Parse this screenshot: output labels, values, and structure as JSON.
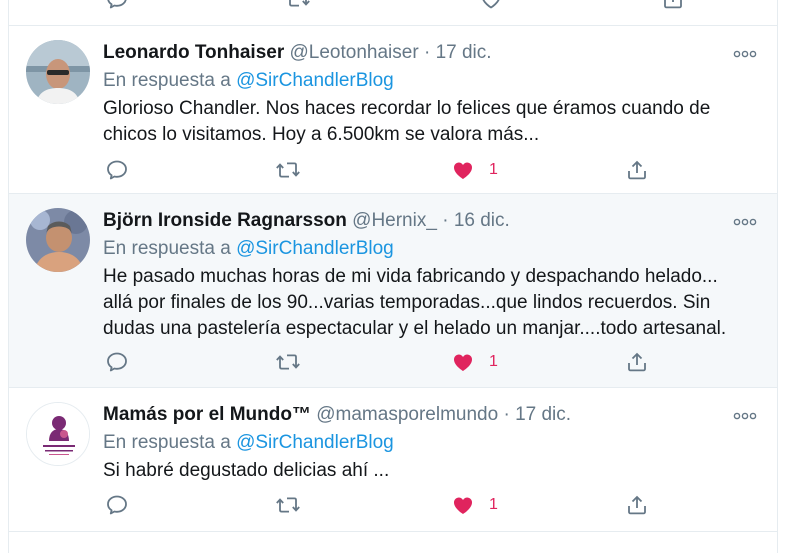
{
  "colors": {
    "link": "#1b95e0",
    "secondary_text": "#657786",
    "primary_text": "#14171a",
    "liked_heart": "#e0245e",
    "divider": "#e6ecf0",
    "highlight_bg": "#f5f8fa"
  },
  "icons": {
    "reply": "reply-icon",
    "retweet": "retweet-icon",
    "like": "heart-icon",
    "share": "share-icon",
    "more": "more-options-icon"
  },
  "tweets": [
    {
      "display_name": "Leonardo Tonhaiser",
      "handle": "@Leotonhaiser",
      "separator": "·",
      "date": "17 dic.",
      "reply_prefix": "En respuesta a",
      "reply_to": "@SirChandlerBlog",
      "text_lines": [
        "Glorioso Chandler. Nos haces recordar lo felices que éramos cuando de",
        "chicos lo visitamos. Hoy a 6.500km se valora más..."
      ],
      "like_count": "1",
      "liked": true
    },
    {
      "display_name": "Björn Ironside Ragnarsson",
      "handle": "@Hernix_",
      "separator": "·",
      "date": "16 dic.",
      "reply_prefix": "En respuesta a",
      "reply_to": "@SirChandlerBlog",
      "text_lines": [
        "He pasado muchas horas de mi vida fabricando y despachando helado...",
        "allá por finales de los 90...varias temporadas...que lindos recuerdos. Sin",
        "dudas una pastelería espectacular y el helado un manjar....todo artesanal."
      ],
      "like_count": "1",
      "liked": true
    },
    {
      "display_name": "Mamás por el Mundo™",
      "handle": "@mamasporelmundo",
      "separator": "·",
      "date": "17 dic.",
      "reply_prefix": "En respuesta a",
      "reply_to": "@SirChandlerBlog",
      "text_lines": [
        "Si habré degustado delicias ahí ..."
      ],
      "like_count": "1",
      "liked": true,
      "avatar_logo_text": "Mamás por el Mundo"
    }
  ]
}
